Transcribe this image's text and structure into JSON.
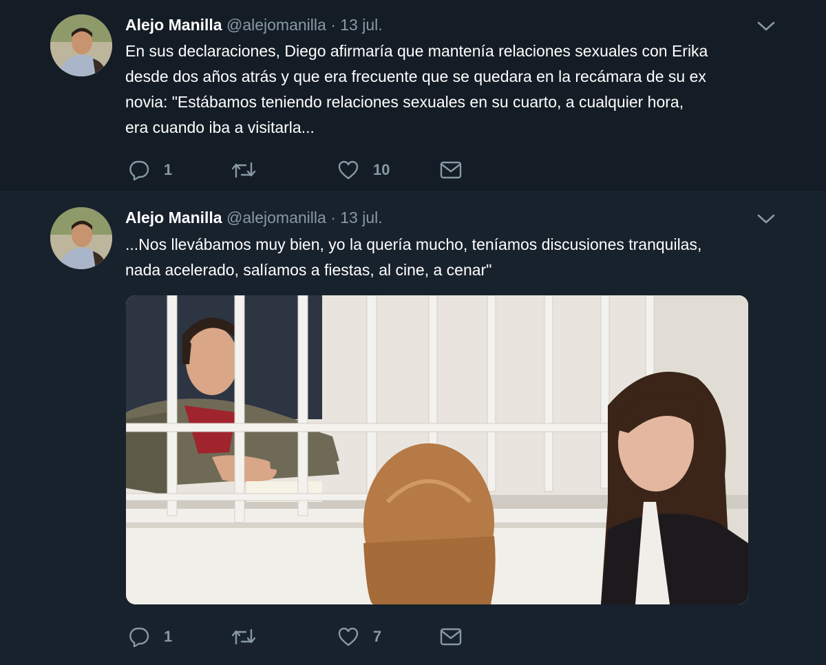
{
  "colors": {
    "background": "#141d26",
    "thread_line": "#1f6fa8",
    "secondary_text": "#8899a6"
  },
  "tweets": [
    {
      "author": "Alejo Manilla",
      "handle": "@alejomanilla",
      "separator": "·",
      "date": "13 jul.",
      "text_lines": [
        "En sus declaraciones, Diego afirmaría que mantenía relaciones sexuales con Erika",
        "desde dos años atrás y que era frecuente que se quedara en la recámara de su ex",
        "novia: \"Estábamos teniendo relaciones sexuales en su cuarto, a cualquier hora,",
        "era cuando iba a visitarla..."
      ],
      "replies": "1",
      "retweets": "",
      "likes": "10",
      "icons": [
        "reply-icon",
        "retweet-icon",
        "like-icon",
        "message-icon",
        "chevron-down-icon"
      ]
    },
    {
      "author": "Alejo Manilla",
      "handle": "@alejomanilla",
      "separator": "·",
      "date": "13 jul.",
      "text_lines": [
        "...Nos llevábamos muy bien, yo la quería mucho, teníamos discusiones tranquilas,",
        "nada acelerado, salíamos a fiestas, al cine, a cenar\""
      ],
      "replies": "1",
      "retweets": "",
      "likes": "7",
      "icons": [
        "reply-icon",
        "retweet-icon",
        "like-icon",
        "message-icon",
        "chevron-down-icon"
      ]
    }
  ]
}
